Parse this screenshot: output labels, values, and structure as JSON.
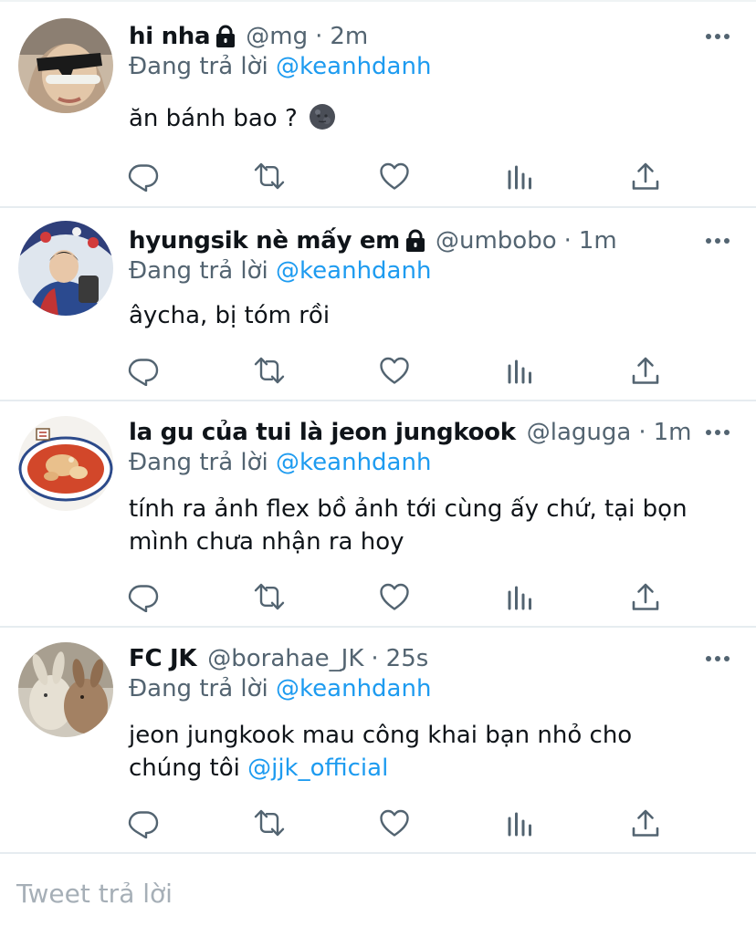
{
  "tweets": [
    {
      "name": "hi nha",
      "protected": true,
      "handle": "@mg",
      "time": "2m",
      "reply_prefix": "Đang trả lời",
      "reply_to": "@keanhdanh",
      "text": "ăn bánh bao ?",
      "emoji": "new-moon-face-emoji",
      "avatar": "sunglasses-woman-avatar"
    },
    {
      "name": "hyungsik nè mấy em",
      "protected": true,
      "handle": "@umbobo",
      "time": "1m",
      "reply_prefix": "Đang trả lời",
      "reply_to": "@keanhdanh",
      "text": "âycha, bị tóm rồi",
      "avatar": "boy-with-umbrella-avatar"
    },
    {
      "name": "la gu của tui là jeon jungkook",
      "protected": false,
      "handle": "@laguga",
      "time": "1m",
      "reply_prefix": "Đang trả lời",
      "reply_to": "@keanhdanh",
      "text_line1": "tính ra ảnh flex bồ ảnh tới cùng ấy chứ, tại bọn",
      "text_line2": "mình chưa nhận ra hoy",
      "avatar": "food-bowl-avatar"
    },
    {
      "name": "FC JK",
      "protected": false,
      "handle": "@borahae_JK",
      "time": "25s",
      "reply_prefix": "Đang trả lời",
      "reply_to": "@keanhdanh",
      "text_line1": "jeon jungkook mau công khai bạn nhỏ cho",
      "text_line2_prefix": "chúng tôi",
      "text_line2_mention": "@jjk_official",
      "avatar": "plush-bunnies-avatar"
    }
  ],
  "separator": "·",
  "actions": [
    "reply-icon",
    "retweet-icon",
    "like-icon",
    "analytics-icon",
    "share-icon"
  ],
  "composer": {
    "placeholder": "Tweet trả lời"
  },
  "colors": {
    "text": "#0f1419",
    "muted": "#536471",
    "link": "#1d9bf0",
    "divider": "#e6ecf0",
    "placeholder": "#a6afb7"
  }
}
